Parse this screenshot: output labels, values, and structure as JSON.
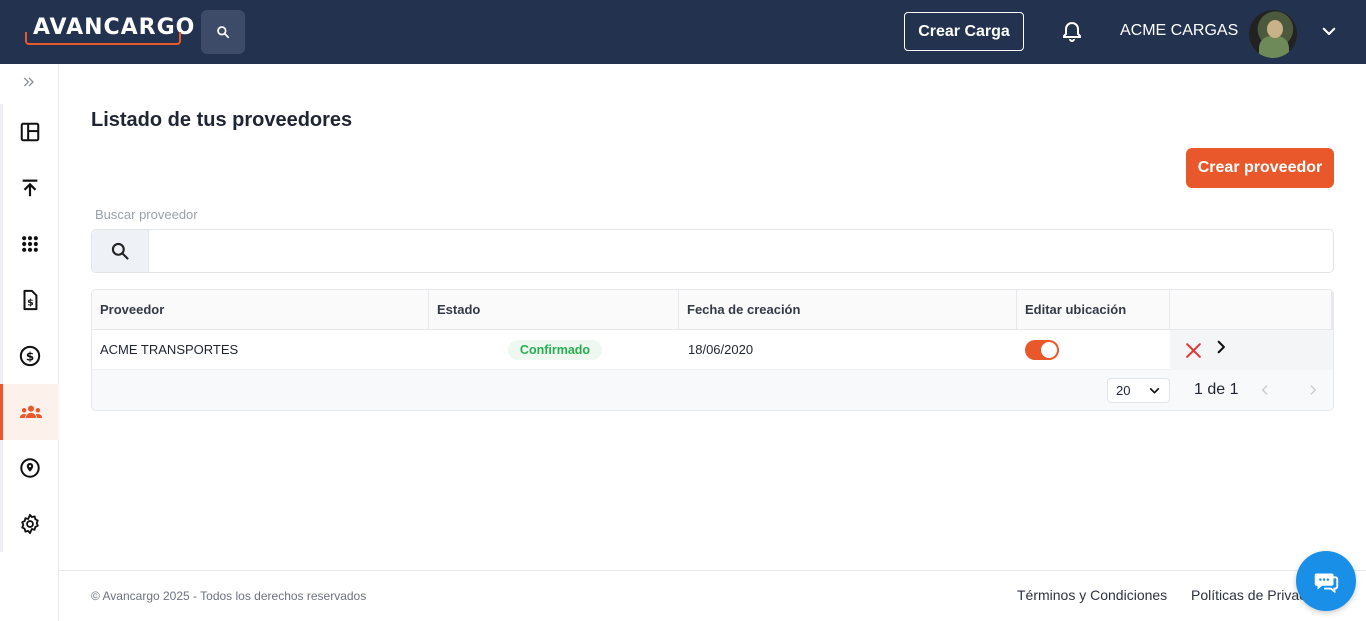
{
  "header": {
    "logo_text": "AVANCARGO",
    "create_load_label": "Crear Carga",
    "company_name": "ACME CARGAS"
  },
  "sidebar": {
    "items": [
      {
        "icon": "dashboard-icon"
      },
      {
        "icon": "upload-icon"
      },
      {
        "icon": "apps-grid-icon"
      },
      {
        "icon": "invoice-icon"
      },
      {
        "icon": "dollar-icon"
      },
      {
        "icon": "providers-icon",
        "active": true
      },
      {
        "icon": "location-icon"
      },
      {
        "icon": "settings-icon"
      }
    ]
  },
  "main": {
    "title": "Listado de tus proveedores",
    "create_provider_label": "Crear proveedor",
    "search": {
      "label": "Buscar proveedor",
      "value": ""
    },
    "table": {
      "columns": [
        "Proveedor",
        "Estado",
        "Fecha de creación",
        "Editar ubicación",
        ""
      ],
      "rows": [
        {
          "provider": "ACME TRANSPORTES",
          "status": "Confirmado",
          "created": "18/06/2020",
          "edit_location": true
        }
      ],
      "pagination": {
        "page_size": "20",
        "page_info": "1 de 1"
      }
    }
  },
  "footer": {
    "copyright": "© Avancargo 2025 - Todos los derechos reservados",
    "terms": "Términos y Condiciones",
    "privacy": "Políticas de Privacidad"
  },
  "colors": {
    "header_bg": "#23324f",
    "accent": "#e8582b",
    "status_green": "#27ae50",
    "chat_blue": "#1a8fe8"
  }
}
